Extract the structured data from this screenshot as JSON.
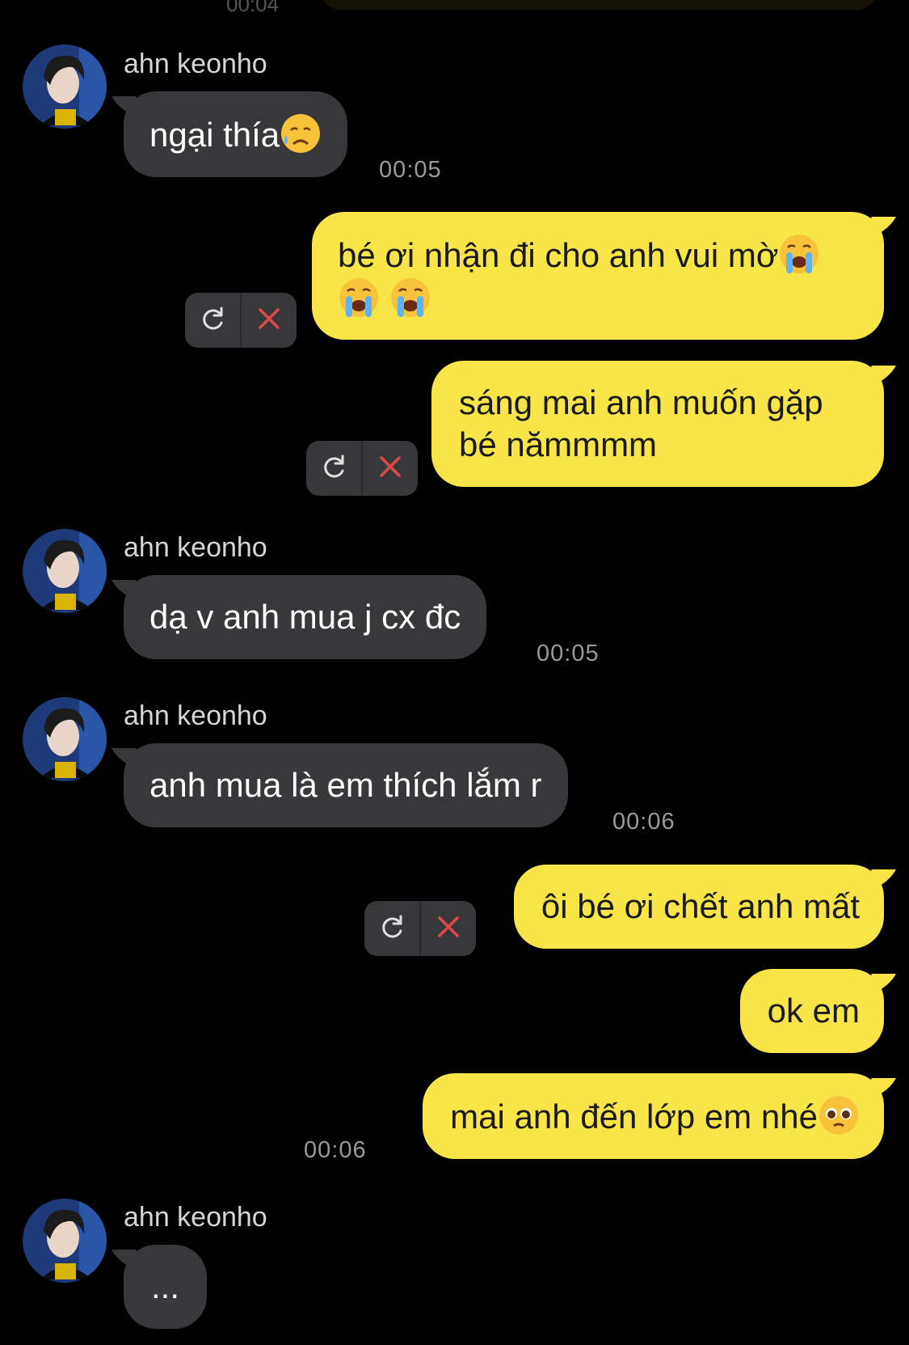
{
  "top": {
    "time": "00:04"
  },
  "messages": {
    "m1": {
      "sender": "ahn keonho",
      "text": "ngại thía",
      "time": "00:05"
    },
    "m2": {
      "line1": "bé ơi nhận đi cho anh vui mờ",
      "line2": ""
    },
    "m3": {
      "line1": "sáng mai anh muốn gặp",
      "line2": "bé nămmmm"
    },
    "m4": {
      "sender": "ahn keonho",
      "text": "dạ v anh mua j cx đc",
      "time": "00:05"
    },
    "m5": {
      "sender": "ahn keonho",
      "text": "anh mua là em thích lắm r",
      "time": "00:06"
    },
    "m6": {
      "text": "ôi bé ơi chết anh mất"
    },
    "m7": {
      "text": "ok em"
    },
    "m8": {
      "text": "mai anh đến lớp em nhé",
      "time": "00:06"
    },
    "m9": {
      "sender": "ahn keonho",
      "text": "..."
    }
  },
  "icons": {
    "retry": "retry-icon",
    "delete": "close-icon",
    "emoji_sad": "sad-tear-emoji",
    "emoji_cry": "crying-emoji",
    "emoji_plead": "pleading-emoji"
  },
  "colors": {
    "background": "#000000",
    "incoming_bubble": "#38383a",
    "outgoing_bubble": "#fae549",
    "delete_icon": "#e0474c"
  }
}
